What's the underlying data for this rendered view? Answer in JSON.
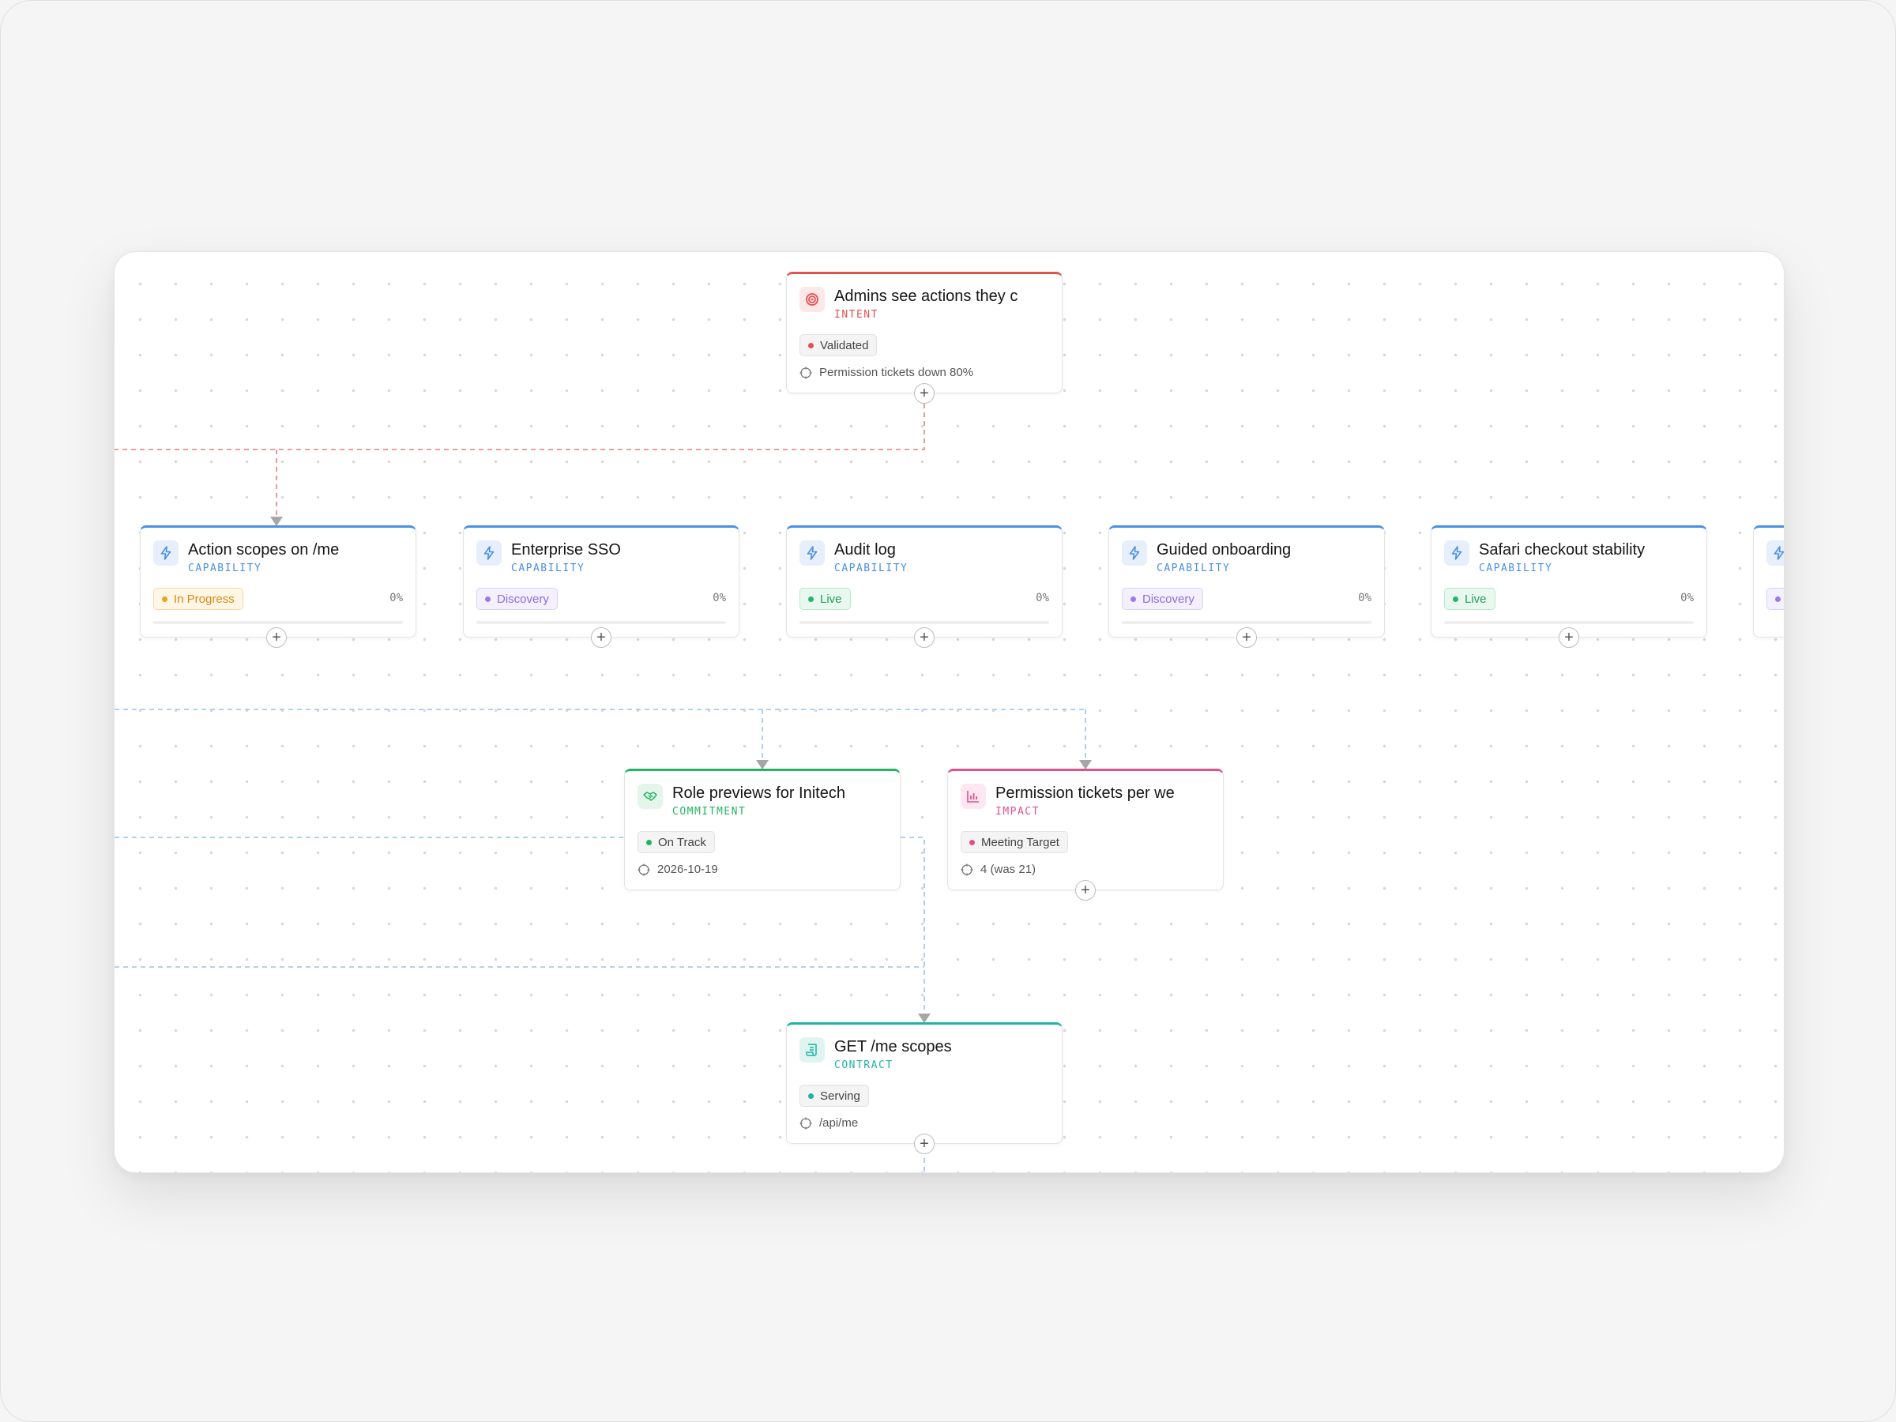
{
  "intent": {
    "title": "Admins see actions they c",
    "type": "INTENT",
    "status": "Validated",
    "metric": "Permission tickets down 80%",
    "accent": "#e05252"
  },
  "capabilities": [
    {
      "title": "Action scopes on /me",
      "type": "CAPABILITY",
      "status": "In Progress",
      "percent": "0%",
      "progress": 0
    },
    {
      "title": "Enterprise SSO",
      "type": "CAPABILITY",
      "status": "Discovery",
      "percent": "0%",
      "progress": 0
    },
    {
      "title": "Audit log",
      "type": "CAPABILITY",
      "status": "Live",
      "percent": "0%",
      "progress": 0
    },
    {
      "title": "Guided onboarding",
      "type": "CAPABILITY",
      "status": "Discovery",
      "percent": "0%",
      "progress": 0
    },
    {
      "title": "Safari checkout stability",
      "type": "CAPABILITY",
      "status": "Live",
      "percent": "0%",
      "progress": 0
    }
  ],
  "commitment": {
    "title": "Role previews for Initech",
    "type": "COMMITMENT",
    "status": "On Track",
    "date": "2026-10-19",
    "accent": "#22b560"
  },
  "impact": {
    "title": "Permission tickets per we",
    "type": "IMPACT",
    "status": "Meeting Target",
    "value": "4 (was 21)",
    "accent": "#e0508f"
  },
  "contract": {
    "title": "GET /me scopes",
    "type": "CONTRACT",
    "status": "Serving",
    "endpoint": "/api/me",
    "accent": "#1fb3a3"
  },
  "colors": {
    "capability": "#4a90e2",
    "in_progress": "#f0a020",
    "discovery": "#9b7be8",
    "live": "#23b869",
    "edge_intent": "#e57f7f",
    "edge_capability": "#9cc0ec"
  },
  "icons": {
    "intent": "target-icon",
    "capability": "lightning-icon",
    "commitment": "handshake-icon",
    "impact": "bar-chart-icon",
    "contract": "scroll-icon",
    "meta": "crosshair-icon",
    "add": "plus-icon"
  },
  "add_label": "+"
}
